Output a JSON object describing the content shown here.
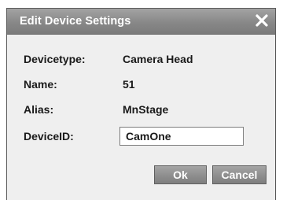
{
  "dialog": {
    "title": "Edit Device Settings",
    "close_icon": "close-x-icon"
  },
  "fields": {
    "devicetype": {
      "label": "Devicetype:",
      "value": "Camera Head"
    },
    "name": {
      "label": "Name:",
      "value": "51"
    },
    "alias": {
      "label": "Alias:",
      "value": "MnStage"
    },
    "deviceid": {
      "label": "DeviceID:",
      "value": "CamOne"
    }
  },
  "buttons": {
    "ok_label": "Ok",
    "cancel_label": "Cancel"
  },
  "colors": {
    "titlebar": "#8c8c8c",
    "dialog_bg": "#efefef",
    "button": "#8c8c8c"
  }
}
